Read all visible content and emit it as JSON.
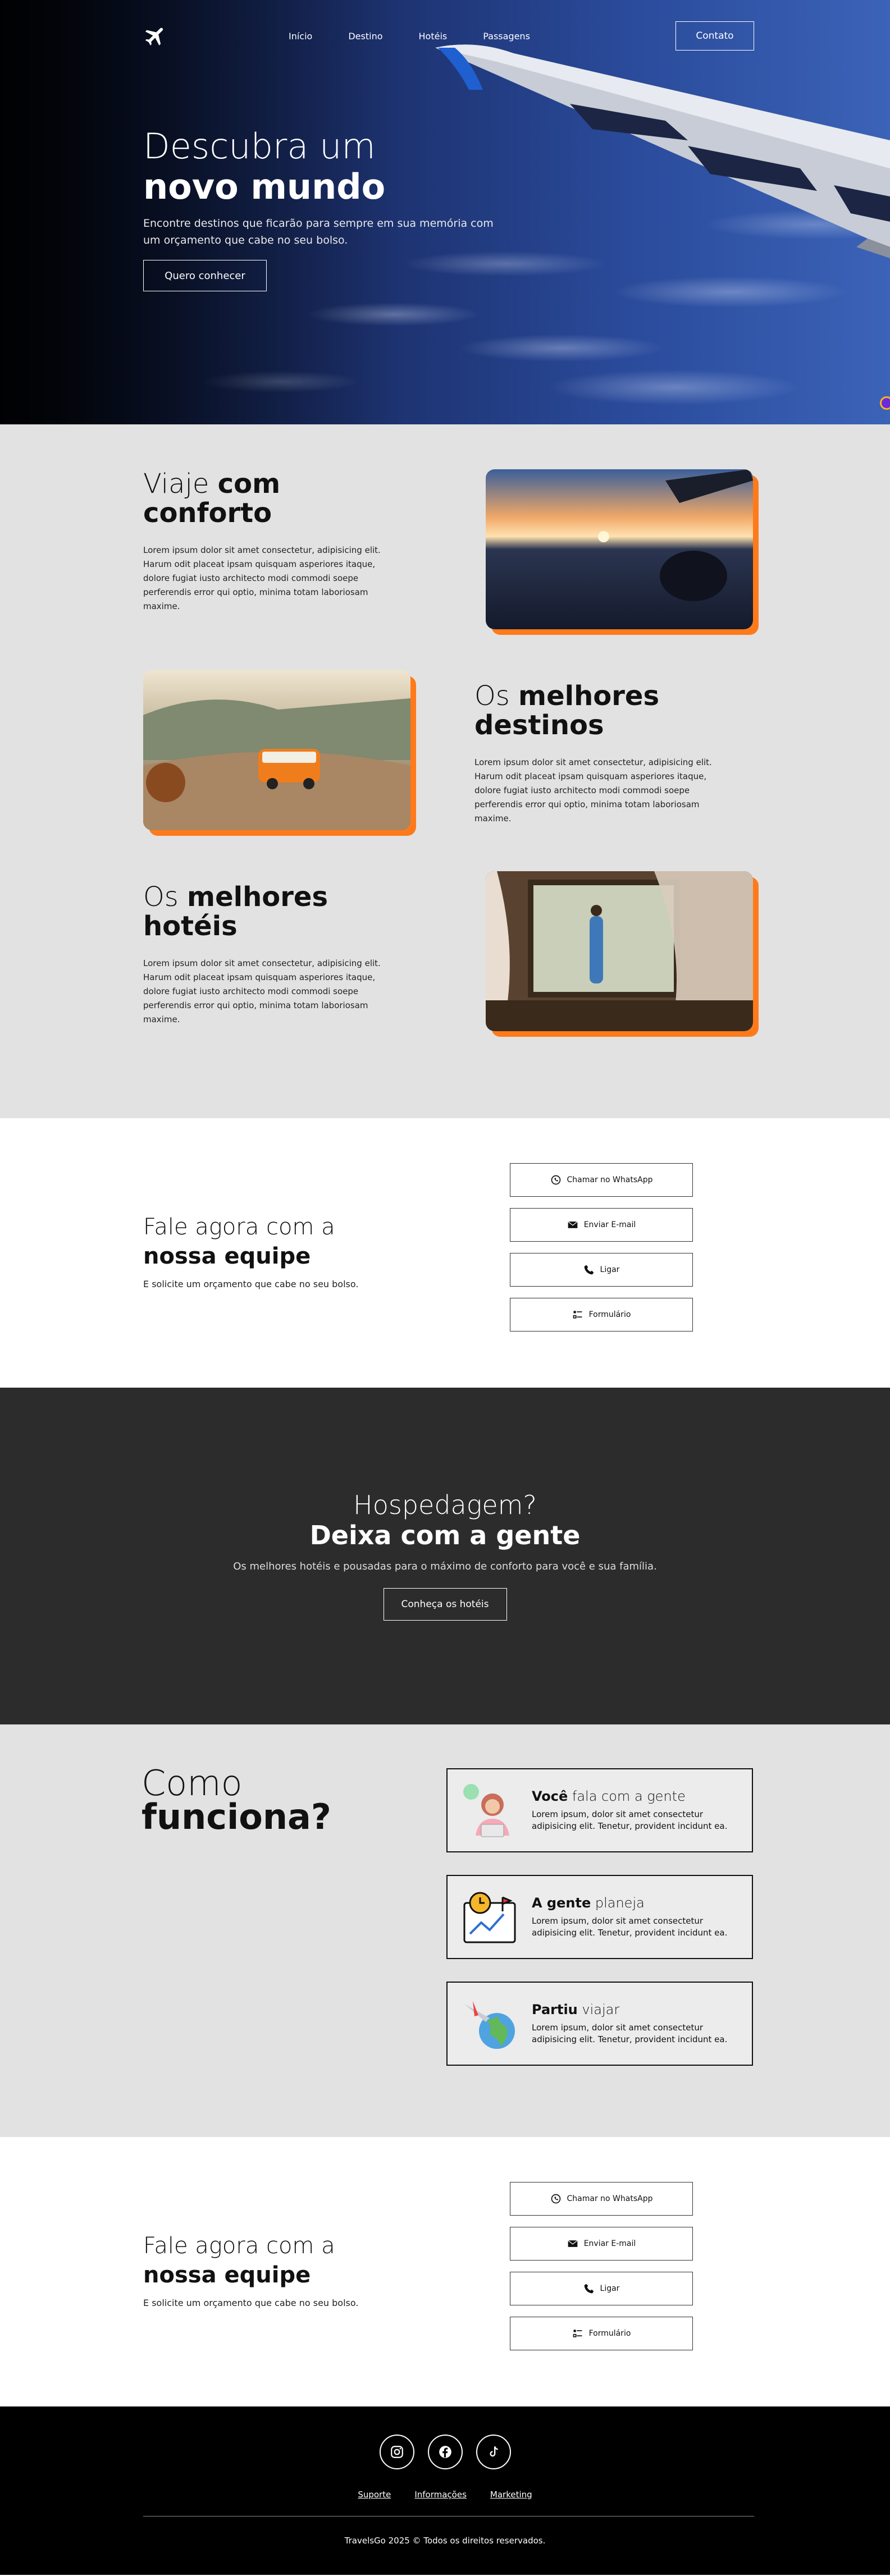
{
  "nav": {
    "links": [
      "Início",
      "Destino",
      "Hotéis",
      "Passagens"
    ],
    "contact": "Contato"
  },
  "hero": {
    "title_light": "Descubra um",
    "title_bold": "novo mundo",
    "text": "Encontre destinos que ficarão para sempre em sua memória com um orçamento que cabe no seu bolso.",
    "button": "Quero conhecer"
  },
  "features": [
    {
      "light": "Viaje ",
      "bold": "com conforto",
      "text": "Lorem ipsum dolor sit amet consectetur, adipisicing elit. Harum odit placeat ipsam quisquam asperiores itaque, dolore fugiat iusto architecto modi commodi soepe perferendis error qui optio, minima totam laboriosam maxime."
    },
    {
      "light": "Os ",
      "bold": "melhores destinos",
      "text": "Lorem ipsum dolor sit amet consectetur, adipisicing elit. Harum odit placeat ipsam quisquam asperiores itaque, dolore fugiat iusto architecto modi commodi soepe perferendis error qui optio, minima totam laboriosam maxime."
    },
    {
      "light": "Os ",
      "bold": "melhores hotéis",
      "text": "Lorem ipsum dolor sit amet consectetur, adipisicing elit. Harum odit placeat ipsam quisquam asperiores itaque, dolore fugiat iusto architecto modi commodi soepe perferendis error qui optio, minima totam laboriosam maxime."
    }
  ],
  "contact": {
    "title_light": "Fale agora com a",
    "title_bold": "nossa equipe",
    "text": "E solicite um orçamento que cabe no seu bolso.",
    "buttons": [
      "Chamar no WhatsApp",
      "Enviar E-mail",
      "Ligar",
      "Formulário"
    ]
  },
  "hosp": {
    "title_light": "Hospedagem?",
    "title_bold": "Deixa com a gente",
    "text": "Os melhores hotéis e pousadas para o máximo de conforto para você e sua família.",
    "button": "Conheça os hotéis"
  },
  "how": {
    "title_light": "Como",
    "title_bold": "funciona?",
    "steps": [
      {
        "bold": "Você",
        "light": " fala com a gente",
        "text": "Lorem ipsum, dolor sit amet consectetur adipisicing elit. Tenetur, provident incidunt ea."
      },
      {
        "bold": "A gente",
        "light": " planeja",
        "text": "Lorem ipsum, dolor sit amet consectetur adipisicing elit. Tenetur, provident incidunt ea."
      },
      {
        "bold": "Partiu",
        "light": " viajar",
        "text": "Lorem ipsum, dolor sit amet consectetur adipisicing elit. Tenetur, provident incidunt ea."
      }
    ]
  },
  "footer": {
    "links": [
      "Suporte",
      "Informações",
      "Marketing"
    ],
    "copyright": "TravelsGo 2025 © Todos os direitos reservados."
  },
  "colors": {
    "accent": "#ff7a1a",
    "dark": "#2c2c2c",
    "light": "#e2e2e2"
  }
}
